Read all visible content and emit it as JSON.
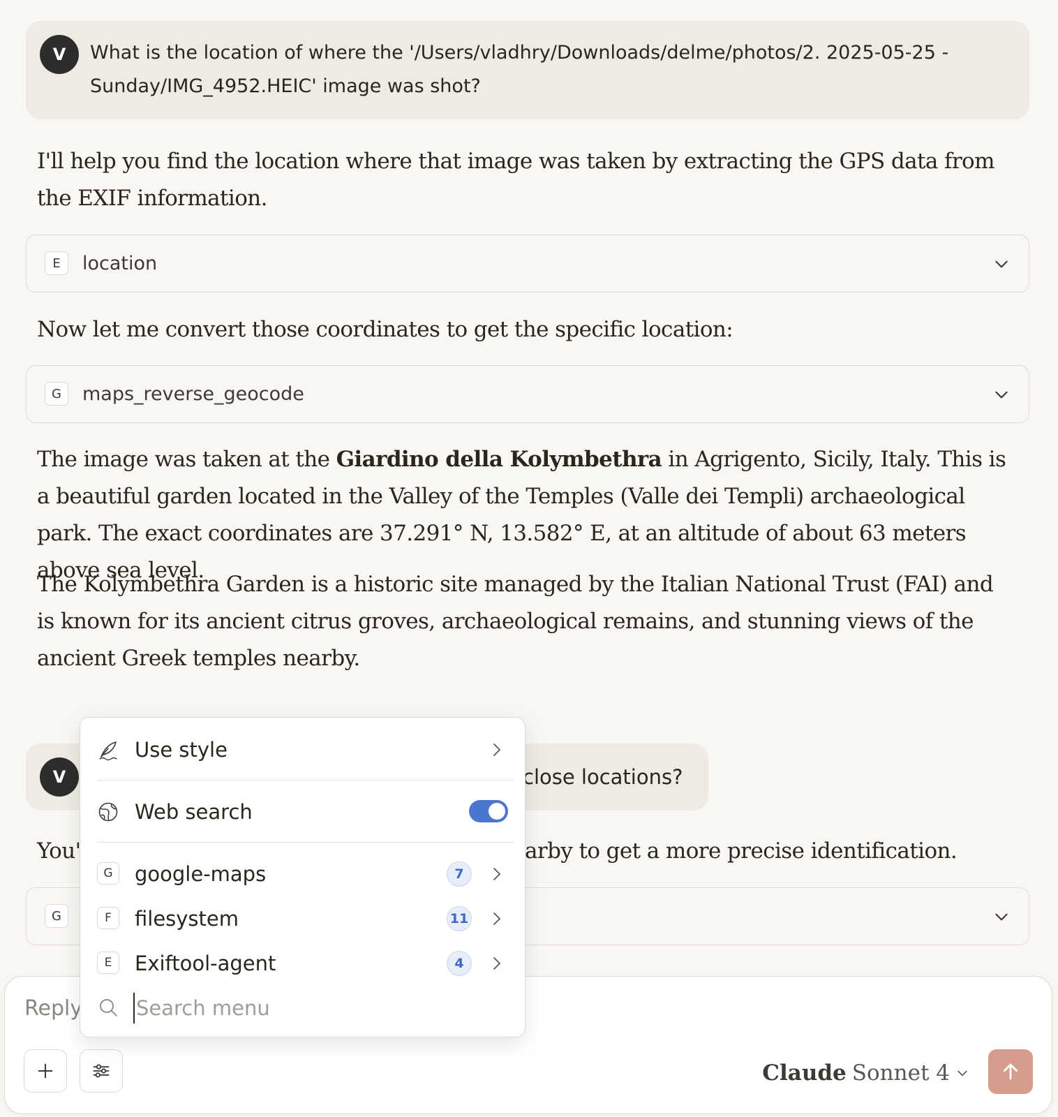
{
  "conversation": {
    "first_user_message": {
      "avatar": "V",
      "text": "What is the location of where the '/Users/vladhry/Downloads/delme/photos/2. 2025-05-25 - Sunday/IMG_4952.HEIC' image was shot?"
    },
    "assistant_intro": "I'll help you find the location where that image was taken by extracting the GPS data from the EXIF information.",
    "tool_call_1": {
      "letter": "E",
      "name": "location"
    },
    "assistant_convert": "Now let me convert those coordinates to get the specific location:",
    "tool_call_2": {
      "letter": "G",
      "name": "maps_reverse_geocode"
    },
    "result_paragraph": {
      "before": "The image was taken at the ",
      "bold": "Giardino della Kolymbethra",
      "after": " in Agrigento, Sicily, Italy. This is a beautiful garden located in the Valley of the Temples (Valle dei Templi) archaeological park. The exact coordinates are 37.291° N, 13.582° E, at an altitude of about 63 meters above sea level."
    },
    "garden_paragraph": "The Kolymbethra Garden is a historic site managed by the Italian National Trust (FAI) and is known for its ancient citrus groves, archaeological remains, and stunning views of the ancient Greek temples nearby.",
    "second_user_message": {
      "avatar": "V",
      "visible_text": "close locations?"
    },
    "assistant_partial_left": "You'",
    "assistant_partial_right": "arby to get a more precise identification.",
    "tool_call_3": {
      "letter": "G"
    }
  },
  "composer": {
    "placeholder": "Reply",
    "model_brand": "Claude",
    "model_name": "Sonnet 4"
  },
  "menu": {
    "use_style": "Use style",
    "web_search": "Web search",
    "web_search_enabled": true,
    "servers": [
      {
        "letter": "G",
        "name": "google-maps",
        "count": "7"
      },
      {
        "letter": "F",
        "name": "filesystem",
        "count": "11"
      },
      {
        "letter": "E",
        "name": "Exiftool-agent",
        "count": "4"
      }
    ],
    "search_placeholder": "Search menu"
  },
  "colors": {
    "background": "#f8f7f3",
    "user_bubble": "#edebe4",
    "toggle_on": "#4a76d1",
    "send_button": "#d59d8b",
    "badge_text": "#3f68c6"
  }
}
